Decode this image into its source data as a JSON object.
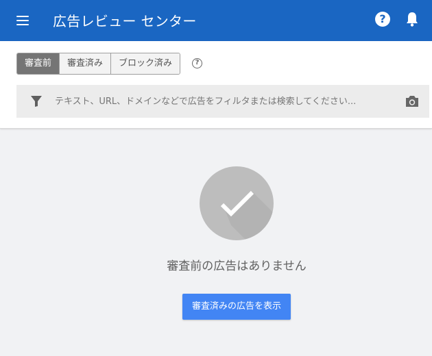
{
  "header": {
    "title": "広告レビュー センター",
    "background": "#1a66c2",
    "help_glyph": "?",
    "icons": [
      "menu-icon",
      "help-icon",
      "bell-icon"
    ]
  },
  "tabs": [
    {
      "label": "審査前",
      "active": true
    },
    {
      "label": "審査済み",
      "active": false
    },
    {
      "label": "ブロック済み",
      "active": false
    }
  ],
  "info_glyph": "?",
  "search": {
    "placeholder": "テキスト、URL、ドメインなどで広告をフィルタまたは検索してください...",
    "value": "",
    "icons": [
      "filter-icon",
      "camera-icon"
    ]
  },
  "empty_state": {
    "icon": "checkmark-icon",
    "message": "審査前の広告はありません",
    "button_label": "審査済みの広告を表示",
    "button_color": "#4285f4"
  }
}
